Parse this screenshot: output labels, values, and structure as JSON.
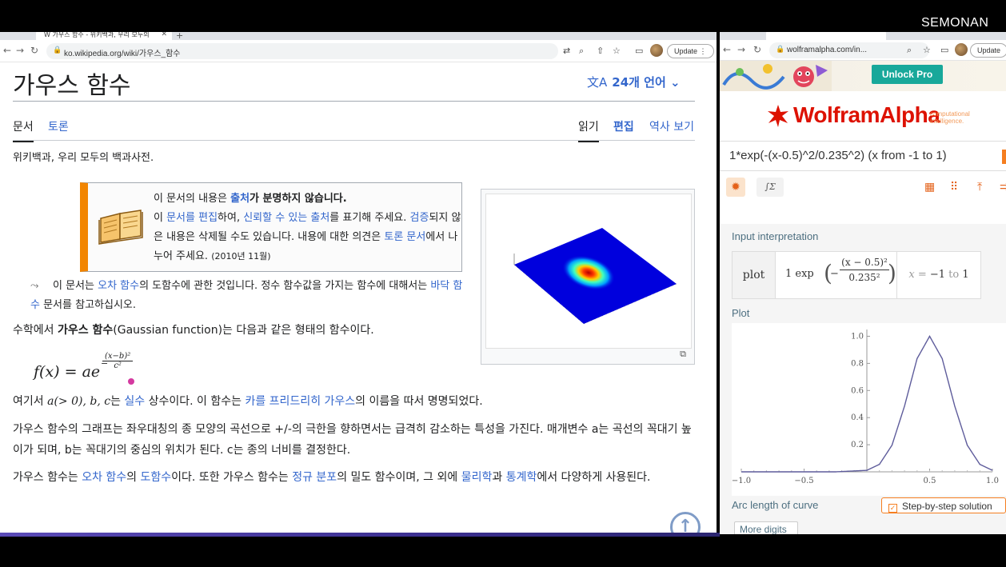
{
  "watermark": "SEMONAN",
  "left_browser": {
    "tab_title": "가우스 함수 - 위키백과, 우리 모두의",
    "url": "ko.wikipedia.org/wiki/가우스_함수",
    "update_label": "Update"
  },
  "wiki": {
    "title": "가우스 함수",
    "languages": "24개 언어",
    "tabs": {
      "article": "문서",
      "talk": "토론",
      "read": "읽기",
      "edit": "편집",
      "history": "역사 보기"
    },
    "tagline": "위키백과, 우리 모두의 백과사전.",
    "ambox": {
      "s1": "이 문서의 내용은 ",
      "s1_link": "출처",
      "s1_bold": "가 분명하지 않습니다.",
      "s2": "이 ",
      "s2_link1": "문서를 편집",
      "s2_b": "하여, ",
      "s2_link2": "신뢰할 수 있는 출처",
      "s2_c": "를 표기해 주세요. ",
      "s2_link3": "검증",
      "s3": "되지 않은 내용은 삭제될 수도 있습니다. 내용에 대한 의견은 ",
      "s3_link": "토론 문서",
      "s3_b": "에서 나누어 주세요. ",
      "date": "(2010년 11월)"
    },
    "hatnote": {
      "a": "이 문서는 ",
      "link1": "오차 함수",
      "b": "의 도함수에 관한 것입니다. 정수 함수값을 가지는 함수에 대해서는 ",
      "link2": "바닥 함수",
      "c": " 문서를 참고하십시오."
    },
    "p1": {
      "a": "수학에서 ",
      "bold": "가우스 함수",
      "b": "(Gaussian function)는 다음과 같은 형태의 함수이다."
    },
    "formula": {
      "lhs": "f(x) = ae",
      "num": "(x−b)²",
      "den": "c²",
      "minus": "−"
    },
    "p2": {
      "a": "여기서 ",
      "math": "a(> 0), b, c",
      "b": "는 ",
      "link1": "실수",
      "c": " 상수이다. 이 함수는 ",
      "link2": "카를 프리드리히 가우스",
      "d": "의 이름을 따서 명명되었다."
    },
    "p3": "가우스 함수의 그래프는 좌우대칭의 종 모양의 곡선으로 +/-의 극한을 향하면서는 급격히 감소하는 특성을 가진다. 매개변수 a는 곡선의 꼭대기 높이가 되며, b는 꼭대기의 중심의 위치가 된다. c는 종의 너비를 결정한다.",
    "p4": {
      "a": "가우스 함수는 ",
      "link1": "오차 함수",
      "b": "의 ",
      "link2": "도함수",
      "c": "이다. 또한 가우스 함수는 ",
      "link3": "정규 분포",
      "d": "의 밀도 함수이며, 그 외에 ",
      "link4": "물리학",
      "e": "과 ",
      "link5": "통계학",
      "f": "에서 다양하게 사용된다."
    }
  },
  "right_browser": {
    "url": "wolframalpha.com/in...",
    "update_label": "Update"
  },
  "wolfram": {
    "unlock": "Unlock Pro",
    "logo": "WolframAlpha",
    "logo_tag1": "computational",
    "logo_tag2": "intelligence.",
    "query": "1*exp(-(x-0.5)^2/0.235^2) (x from -1 to 1)",
    "input_interp_heading": "Input interpretation",
    "interp_label": "plot",
    "interp_expr_prefix": "1 exp",
    "interp_num": "(x − 0.5)²",
    "interp_den": "0.235²",
    "interp_range_x": "x",
    "interp_range_eq": " = ",
    "interp_range_from": "−1",
    "interp_range_to": " to ",
    "interp_range_end": "1",
    "plot_heading": "Plot",
    "arc_heading": "Arc length of curve",
    "step_label": "Step-by-step solution",
    "more_digits": "More digits"
  },
  "chart_data": {
    "type": "line",
    "title": "",
    "xlabel": "",
    "ylabel": "",
    "xlim": [
      -1.0,
      1.0
    ],
    "ylim": [
      0,
      1.05
    ],
    "x_ticks": [
      "−1.0",
      "−0.5",
      "0.5",
      "1.0"
    ],
    "y_ticks": [
      "0.2",
      "0.4",
      "0.6",
      "0.8",
      "1.0"
    ],
    "grid": false,
    "series": [
      {
        "x": [
          -1.0,
          -0.5,
          -0.25,
          0.0,
          0.1,
          0.2,
          0.3,
          0.4,
          0.5,
          0.6,
          0.7,
          0.8,
          0.9,
          1.0
        ],
        "values": [
          0.0,
          0.0,
          0.0,
          0.011,
          0.055,
          0.196,
          0.485,
          0.835,
          1.0,
          0.835,
          0.485,
          0.196,
          0.055,
          0.011
        ]
      }
    ],
    "color": "#5e5c9b"
  }
}
